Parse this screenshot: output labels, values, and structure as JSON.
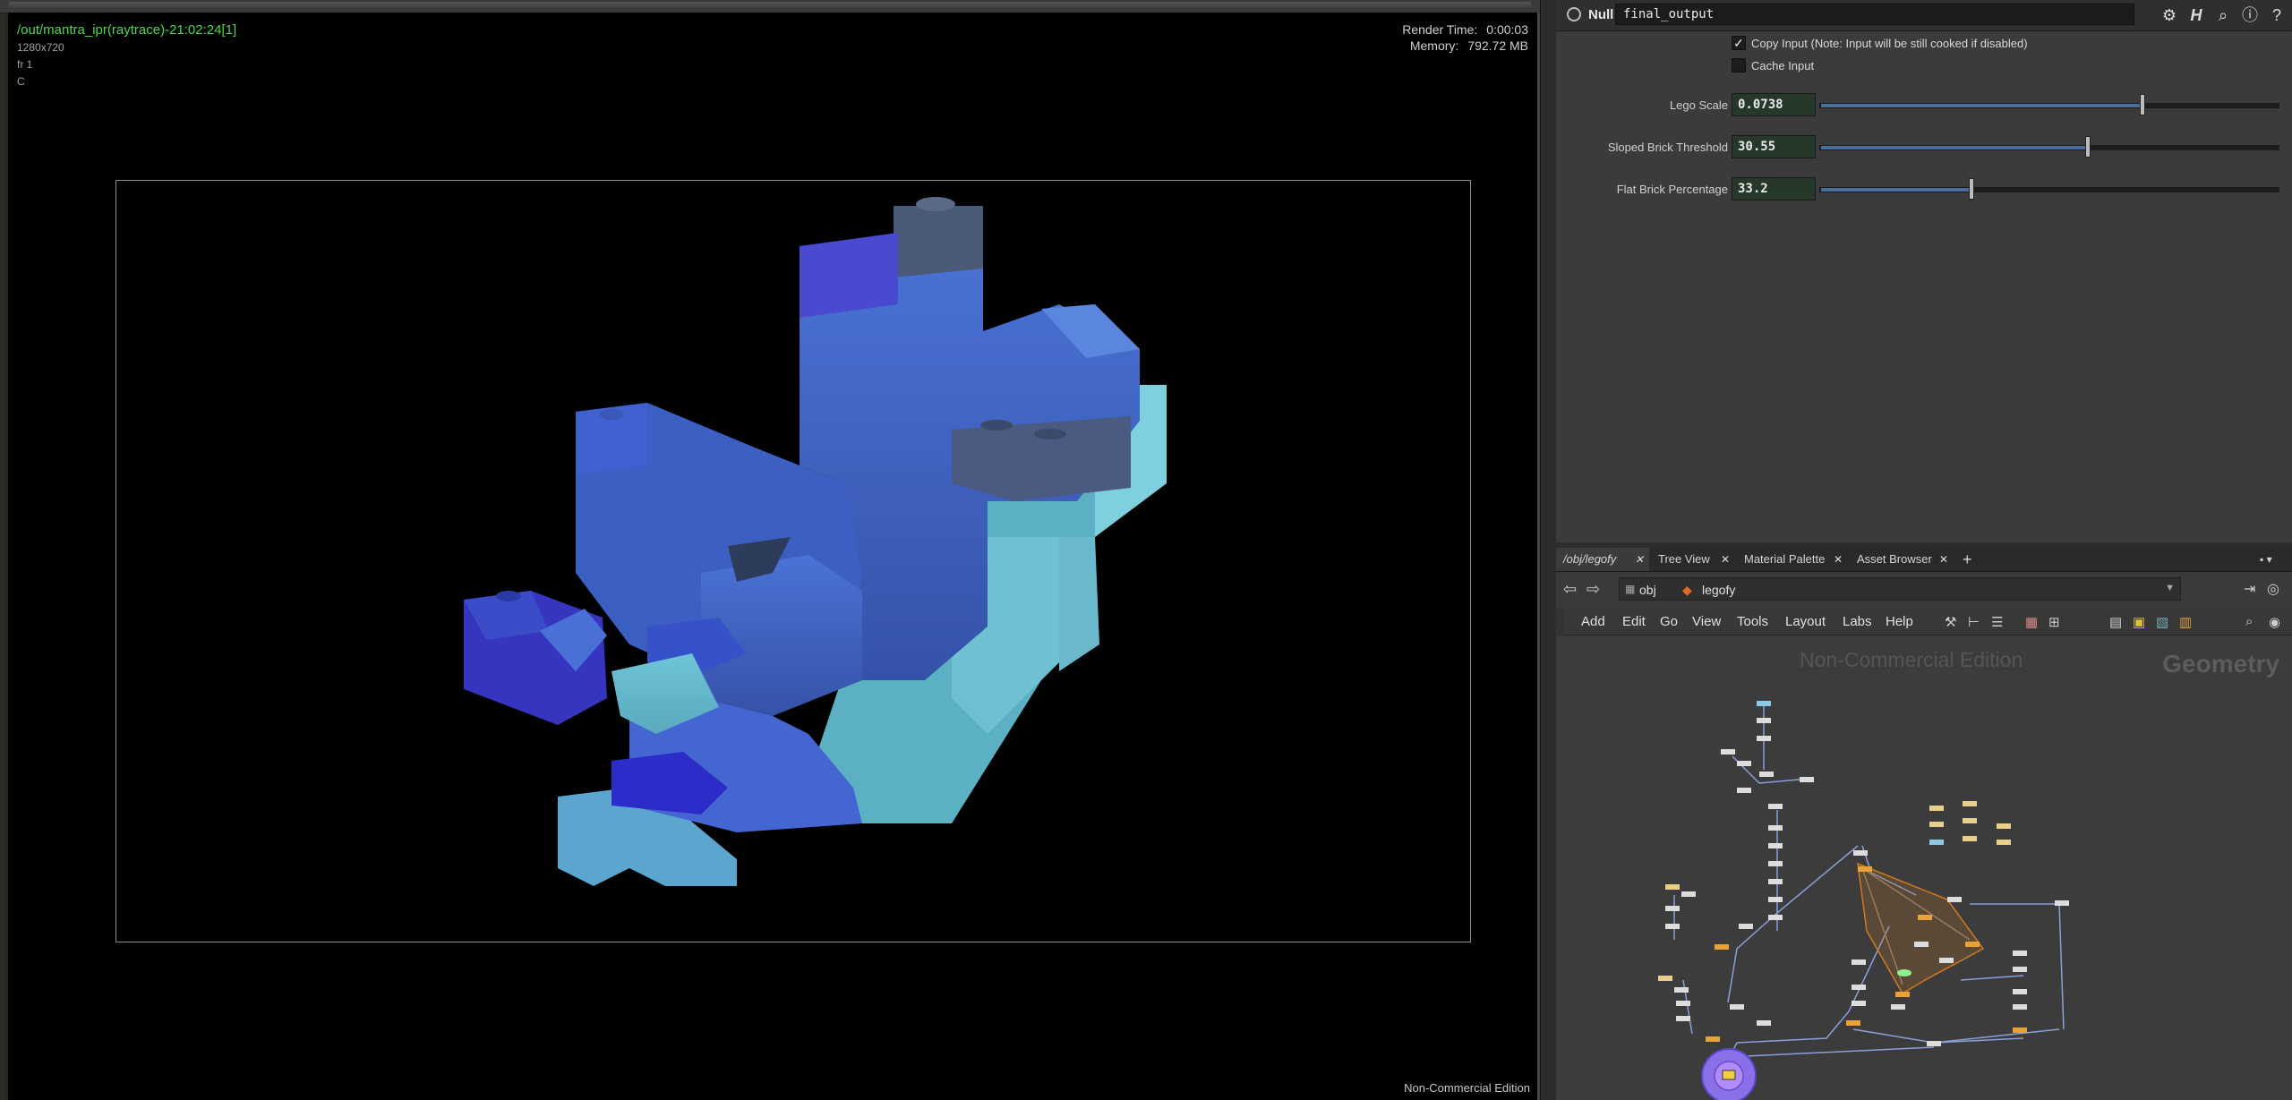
{
  "viewport": {
    "title": "/out/mantra_ipr(raytrace)-21:02:24[1]",
    "resolution": "1280x720",
    "frame": "fr 1",
    "channel": "C",
    "render_time_label": "Render Time:",
    "render_time": "0:00:03",
    "memory_label": "Memory:",
    "memory": "792.72 MB",
    "watermark": "Non-Commercial Edition"
  },
  "parameters": {
    "node_type": "Null",
    "node_name": "final_output",
    "copy_input": {
      "checked": true,
      "label": "Copy Input (Note: Input will be still cooked if disabled)"
    },
    "cache_input": {
      "checked": false,
      "label": "Cache Input"
    },
    "params": [
      {
        "label": "Lego Scale",
        "value": "0.0738",
        "fraction": 0.705
      },
      {
        "label": "Sloped Brick Threshold",
        "value": "30.55",
        "fraction": 0.585
      },
      {
        "label": "Flat Brick Percentage",
        "value": "33.2",
        "fraction": 0.332
      }
    ]
  },
  "network": {
    "tabs": [
      {
        "label": "/obj/legofy"
      },
      {
        "label": "Tree View"
      },
      {
        "label": "Material Palette"
      },
      {
        "label": "Asset Browser"
      }
    ],
    "add_tab_icon": "plus-icon",
    "path": {
      "root": "obj",
      "current": "legofy"
    },
    "menus": [
      "Add",
      "Edit",
      "Go",
      "View",
      "Tools",
      "Layout",
      "Labs",
      "Help"
    ],
    "watermark": "Non-Commercial Edition",
    "context_label": "Geometry"
  },
  "colors": {
    "ipr_title": "#4cd94c",
    "param_field_bg": "#26382a",
    "slider_fill": "#4a6f9e",
    "node_orange": "#e8a23a",
    "subnet_outline": "#d07a1f"
  }
}
